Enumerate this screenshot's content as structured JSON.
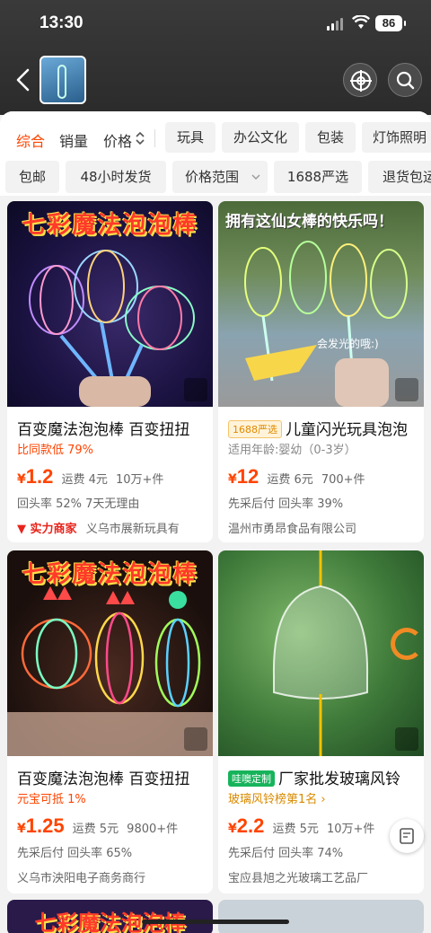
{
  "status": {
    "time": "13:30",
    "battery": "86"
  },
  "sort_tabs": [
    {
      "label": "综合",
      "active": true
    },
    {
      "label": "销量",
      "active": false
    },
    {
      "label": "价格",
      "active": false
    }
  ],
  "category_chips": [
    "玩具",
    "办公文化",
    "包装",
    "灯饰照明"
  ],
  "filter_chips": [
    "包邮",
    "48小时发货",
    "价格范围",
    "1688严选",
    "退货包运费"
  ],
  "products": [
    {
      "banner": "七彩魔法泡泡棒",
      "title": "百变魔法泡泡棒 百变扭扭",
      "badge": "",
      "sub": "比同款低 79%",
      "price_cur": "¥",
      "price": "1.2",
      "shipping": "运费 4元",
      "sales": "10万+件",
      "line2": "回头率 52%  7天无理由",
      "line3_badge": "实力商家",
      "line3": "义乌市展新玩具有"
    },
    {
      "banner": "拥有这仙女棒的快乐吗！",
      "caption": "会发光的哦:)",
      "title": "儿童闪光玩具泡泡",
      "badge": "1688严选",
      "sub": "适用年龄:婴幼（0-3岁）",
      "price_cur": "¥",
      "price": "12",
      "shipping": "运费 6元",
      "sales": "700+件",
      "line2": "先采后付  回头率 39%",
      "line3": "温州市勇昂食品有限公司"
    },
    {
      "banner": "七彩魔法泡泡棒",
      "title": "百变魔法泡泡棒 百变扭扭",
      "badge": "",
      "sub": "元宝可抵 1%",
      "price_cur": "¥",
      "price": "1.25",
      "shipping": "运费 5元",
      "sales": "9800+件",
      "line2": "先采后付  回头率 65%",
      "line3": "义乌市泱阳电子商务商行"
    },
    {
      "title": "厂家批发玻璃风铃",
      "badge": "哇噢定制",
      "sub": "玻璃风铃榜第1名 ›",
      "price_cur": "¥",
      "price": "2.2",
      "shipping": "运费 5元",
      "sales": "10万+件",
      "line2": "先采后付  回头率 74%",
      "line3": "宝应县旭之光玻璃工艺品厂"
    }
  ],
  "bottom_banner": "七彩魔法泡泡棒",
  "colors": {
    "accent": "#ff4400",
    "header_bg": "#2b2b2b",
    "select_badge": "#f5a623",
    "custom_badge": "#17b35b"
  }
}
